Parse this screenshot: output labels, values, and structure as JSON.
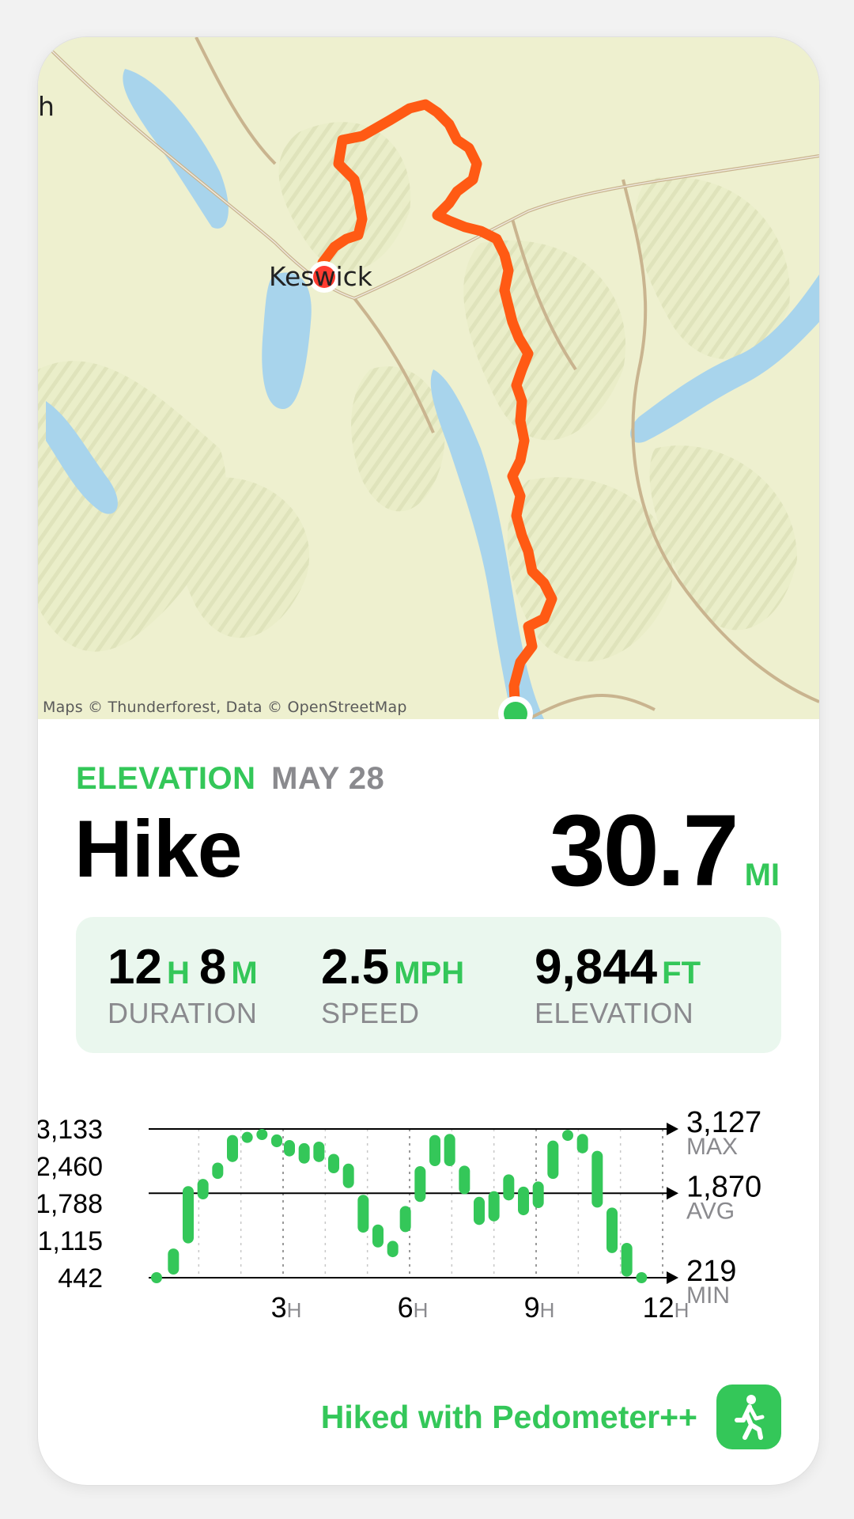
{
  "map": {
    "attribution": "Maps © Thunderforest, Data © OpenStreetMap",
    "place_label": "Keswick",
    "edge_label": "h",
    "route_color": "#ff5a14",
    "start_marker_color": "#34c759",
    "end_marker_color": "#ff3b30"
  },
  "header": {
    "metric_label": "ELEVATION",
    "date": "MAY 28",
    "activity": "Hike",
    "distance_value": "30.7",
    "distance_unit": "MI"
  },
  "stats": {
    "duration_hours": "12",
    "duration_hours_unit": "H",
    "duration_minutes": "8",
    "duration_minutes_unit": "M",
    "duration_label": "DURATION",
    "speed_value": "2.5",
    "speed_unit": "MPH",
    "speed_label": "SPEED",
    "elevation_value": "9,844",
    "elevation_unit": "FT",
    "elevation_label": "ELEVATION"
  },
  "chart_data": {
    "type": "bar",
    "title": "",
    "y_ticks": [
      "3,133",
      "2,460",
      "1,788",
      "1,115",
      "442"
    ],
    "x_ticks": [
      {
        "value": "3",
        "unit": "H"
      },
      {
        "value": "6",
        "unit": "H"
      },
      {
        "value": "9",
        "unit": "H"
      },
      {
        "value": "12",
        "unit": "H"
      }
    ],
    "ylim": [
      219,
      3127
    ],
    "reference_lines": [
      {
        "label": "MAX",
        "value": "3,127"
      },
      {
        "label": "AVG",
        "value": "1,870"
      },
      {
        "label": "MIN",
        "value": "219"
      }
    ],
    "color": "#34c759",
    "x_hours": [
      0.0,
      0.4,
      0.75,
      1.1,
      1.45,
      1.8,
      2.15,
      2.5,
      2.85,
      3.15,
      3.5,
      3.85,
      4.2,
      4.55,
      4.9,
      5.25,
      5.6,
      5.9,
      6.25,
      6.6,
      6.95,
      7.3,
      7.65,
      8.0,
      8.35,
      8.7,
      9.05,
      9.4,
      9.75,
      10.1,
      10.45,
      10.8,
      11.15,
      11.5,
      11.85
    ],
    "ranges": [
      [
        219,
        219
      ],
      [
        280,
        790
      ],
      [
        890,
        2010
      ],
      [
        1750,
        2150
      ],
      [
        2150,
        2470
      ],
      [
        2480,
        3010
      ],
      [
        2880,
        3070
      ],
      [
        3020,
        3127
      ],
      [
        2770,
        3020
      ],
      [
        2590,
        2910
      ],
      [
        2450,
        2850
      ],
      [
        2480,
        2880
      ],
      [
        2260,
        2640
      ],
      [
        1970,
        2450
      ],
      [
        1100,
        1840
      ],
      [
        810,
        1260
      ],
      [
        620,
        940
      ],
      [
        1110,
        1620
      ],
      [
        1700,
        2400
      ],
      [
        2400,
        3010
      ],
      [
        2400,
        3030
      ],
      [
        1850,
        2410
      ],
      [
        1250,
        1800
      ],
      [
        1320,
        1910
      ],
      [
        1730,
        2240
      ],
      [
        1440,
        2000
      ],
      [
        1580,
        2100
      ],
      [
        2150,
        2900
      ],
      [
        2900,
        3110
      ],
      [
        2650,
        3030
      ],
      [
        1590,
        2700
      ],
      [
        700,
        1590
      ],
      [
        240,
        900
      ],
      [
        219,
        219
      ]
    ]
  },
  "footer": {
    "text": "Hiked with Pedometer++",
    "icon": "walking-person-icon"
  }
}
